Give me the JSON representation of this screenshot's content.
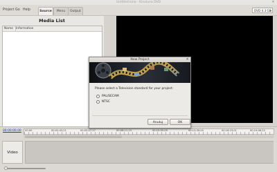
{
  "window": {
    "title": "Untitled.kino - Kinoluna DVD"
  },
  "menu": [
    {
      "label": "Project"
    },
    {
      "label": "Go"
    },
    {
      "label": "Help"
    }
  ],
  "tabs": [
    {
      "label": "Source",
      "active": true
    },
    {
      "label": "Menu",
      "active": false
    },
    {
      "label": "Output",
      "active": false
    }
  ],
  "disk_select": {
    "value": "DVD 4.3 GB"
  },
  "media_list": {
    "title": "Media List",
    "columns": [
      "Name",
      "Information"
    ]
  },
  "toolbar": {
    "add_label": "+",
    "remove_label": "✖",
    "info_label": "⊙"
  },
  "timeline": {
    "current_time": "00:00:00.00",
    "ruler_labels": [
      "00:00",
      "00:02:43.21",
      "00:05:27.17",
      "00:08:11.13",
      "00:10:55.09",
      "00:13:39.05",
      "00:16:23.01",
      "00:19:06.22"
    ],
    "tracks": [
      {
        "label": "Video"
      }
    ]
  },
  "dialog": {
    "title": "New Project",
    "prompt": "Please select a Television standard for your project:",
    "options": [
      {
        "label": "PAL/SECAM",
        "selected": false
      },
      {
        "label": "NTSC",
        "selected": false
      }
    ],
    "cancel_label": "Anuluj",
    "ok_label": "OK"
  },
  "colors": {
    "accent_link": "#2433cc",
    "remove_red": "#cc1111",
    "preview_bg": "#000000"
  }
}
